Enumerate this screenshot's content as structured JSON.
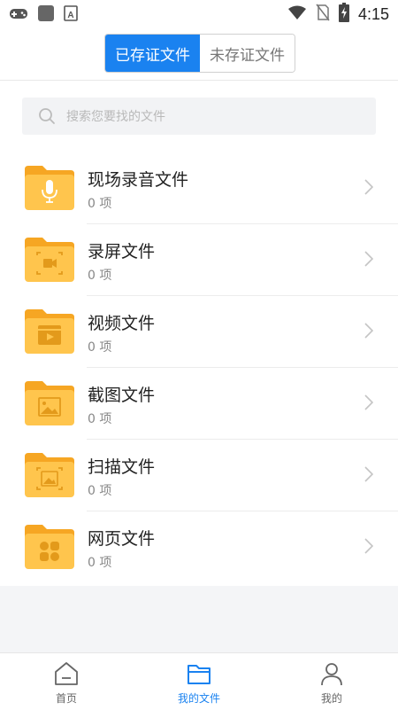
{
  "status_bar": {
    "time": "4:15",
    "left_icons": [
      "gamepad-icon",
      "app-square-icon",
      "font-a-icon"
    ],
    "right_icons": [
      "wifi-icon",
      "no-sim-icon",
      "battery-charging-icon"
    ]
  },
  "header": {
    "tabs": [
      {
        "label": "已存证文件",
        "active": true
      },
      {
        "label": "未存证文件",
        "active": false
      }
    ]
  },
  "search": {
    "placeholder": "搜索您要找的文件"
  },
  "categories": [
    {
      "label": "现场录音文件",
      "count": "0 项",
      "icon": "microphone-icon"
    },
    {
      "label": "录屏文件",
      "count": "0 项",
      "icon": "screen-record-icon"
    },
    {
      "label": "视频文件",
      "count": "0 项",
      "icon": "video-clapper-icon"
    },
    {
      "label": "截图文件",
      "count": "0 项",
      "icon": "screenshot-image-icon"
    },
    {
      "label": "扫描文件",
      "count": "0 项",
      "icon": "scan-image-icon"
    },
    {
      "label": "网页文件",
      "count": "0 项",
      "icon": "webpage-grid-icon"
    }
  ],
  "tabbar": {
    "items": [
      {
        "label": "首页",
        "icon": "home-icon",
        "active": false
      },
      {
        "label": "我的文件",
        "icon": "folder-icon",
        "active": true
      },
      {
        "label": "我的",
        "icon": "person-icon",
        "active": false
      }
    ]
  },
  "colors": {
    "accent": "#1a82f0",
    "folder": "#ffc54d",
    "folder_tab": "#f6a623"
  }
}
